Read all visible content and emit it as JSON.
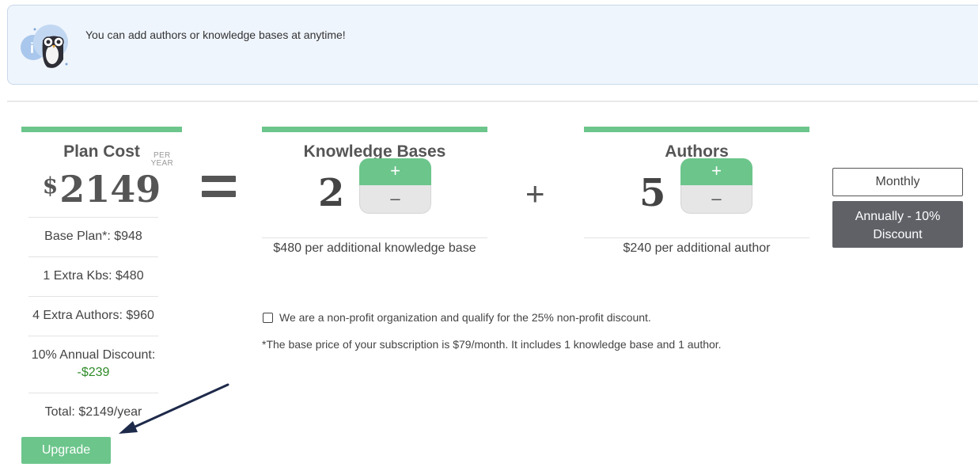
{
  "banner": {
    "message": "You can add authors or knowledge bases at anytime!",
    "icon": "owl-info-icon"
  },
  "plan": {
    "title": "Plan Cost",
    "currency": "$",
    "price": "2149",
    "per_line1": "PER",
    "per_line2": "YEAR",
    "breakdown": {
      "base": "Base Plan*: $948",
      "kbs": "1 Extra Kbs: $480",
      "authors": "4 Extra Authors: $960",
      "discount_label": "10% Annual Discount:",
      "discount_value": "-$239",
      "total": "Total: $2149/year"
    }
  },
  "knowledge_bases": {
    "title": "Knowledge Bases",
    "count": "2",
    "plus": "+",
    "minus": "–",
    "note": "$480 per additional knowledge base"
  },
  "authors": {
    "title": "Authors",
    "count": "5",
    "plus": "+",
    "minus": "–",
    "note": "$240 per additional author"
  },
  "operators": {
    "plus": "+"
  },
  "billing": {
    "monthly": "Monthly",
    "annual": "Annually - 10% Discount",
    "selected": "annual"
  },
  "nonprofit": {
    "label": "We are a non-profit organization and qualify for the 25% non-profit discount.",
    "checked": false
  },
  "footnote": "*The base price of your subscription is $79/month. It includes 1 knowledge base and 1 author.",
  "upgrade_label": "Upgrade",
  "colors": {
    "accent": "#6cc58b",
    "dark_button": "#5f6167",
    "discount": "#2f8a28",
    "banner_bg": "#eff5fd",
    "arrow": "#1e2a4a"
  }
}
